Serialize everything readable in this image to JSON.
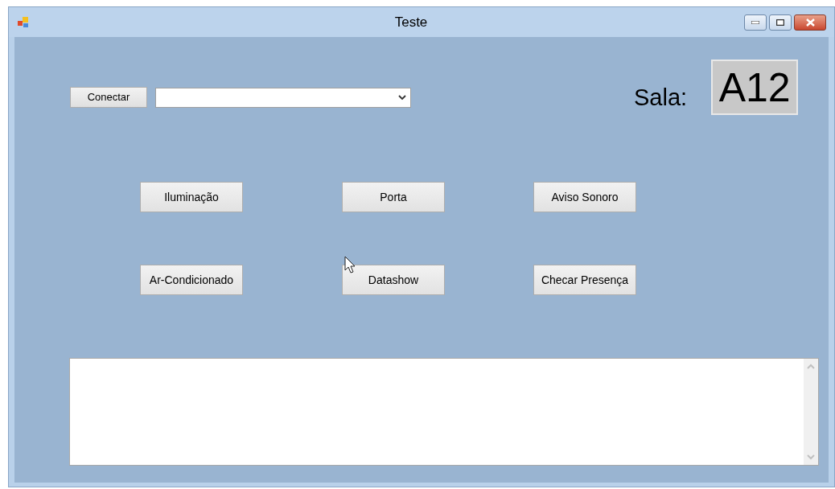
{
  "window": {
    "title": "Teste"
  },
  "connect_button": "Conectar",
  "room": {
    "label": "Sala:",
    "value": "A12"
  },
  "controls": [
    [
      "Iluminação",
      "Porta",
      "Aviso Sonoro"
    ],
    [
      "Ar-Condicionado",
      "Datashow",
      "Checar Presença"
    ]
  ]
}
